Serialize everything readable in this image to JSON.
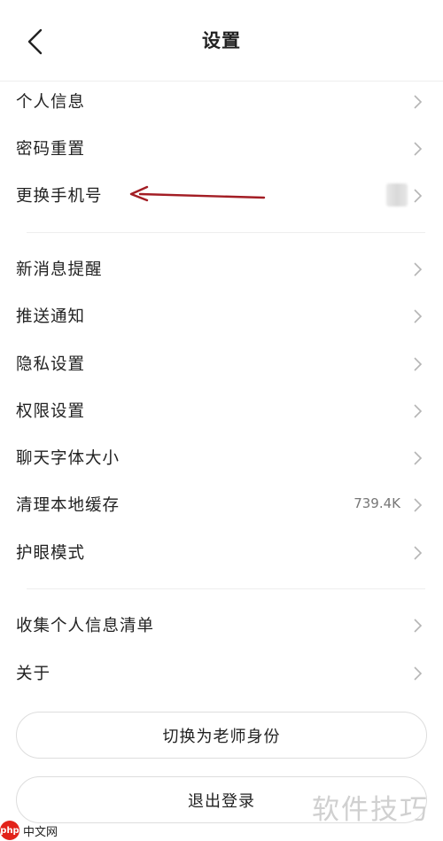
{
  "header": {
    "title": "设置"
  },
  "groups": [
    {
      "items": [
        {
          "label": "个人信息"
        },
        {
          "label": "密码重置"
        },
        {
          "label": "更换手机号",
          "value_masked": true
        }
      ]
    },
    {
      "items": [
        {
          "label": "新消息提醒"
        },
        {
          "label": "推送通知"
        },
        {
          "label": "隐私设置"
        },
        {
          "label": "权限设置"
        },
        {
          "label": "聊天字体大小"
        },
        {
          "label": "清理本地缓存",
          "value": "739.4K"
        },
        {
          "label": "护眼模式"
        }
      ]
    },
    {
      "items": [
        {
          "label": "收集个人信息清单"
        },
        {
          "label": "关于"
        }
      ]
    }
  ],
  "buttons": {
    "switch_role": "切换为老师身份",
    "logout": "退出登录"
  },
  "annotation": {
    "arrow_color": "#a31d24"
  },
  "watermarks": {
    "left_logo": "php",
    "left_text": "中文网",
    "right_text": "软件技巧"
  }
}
